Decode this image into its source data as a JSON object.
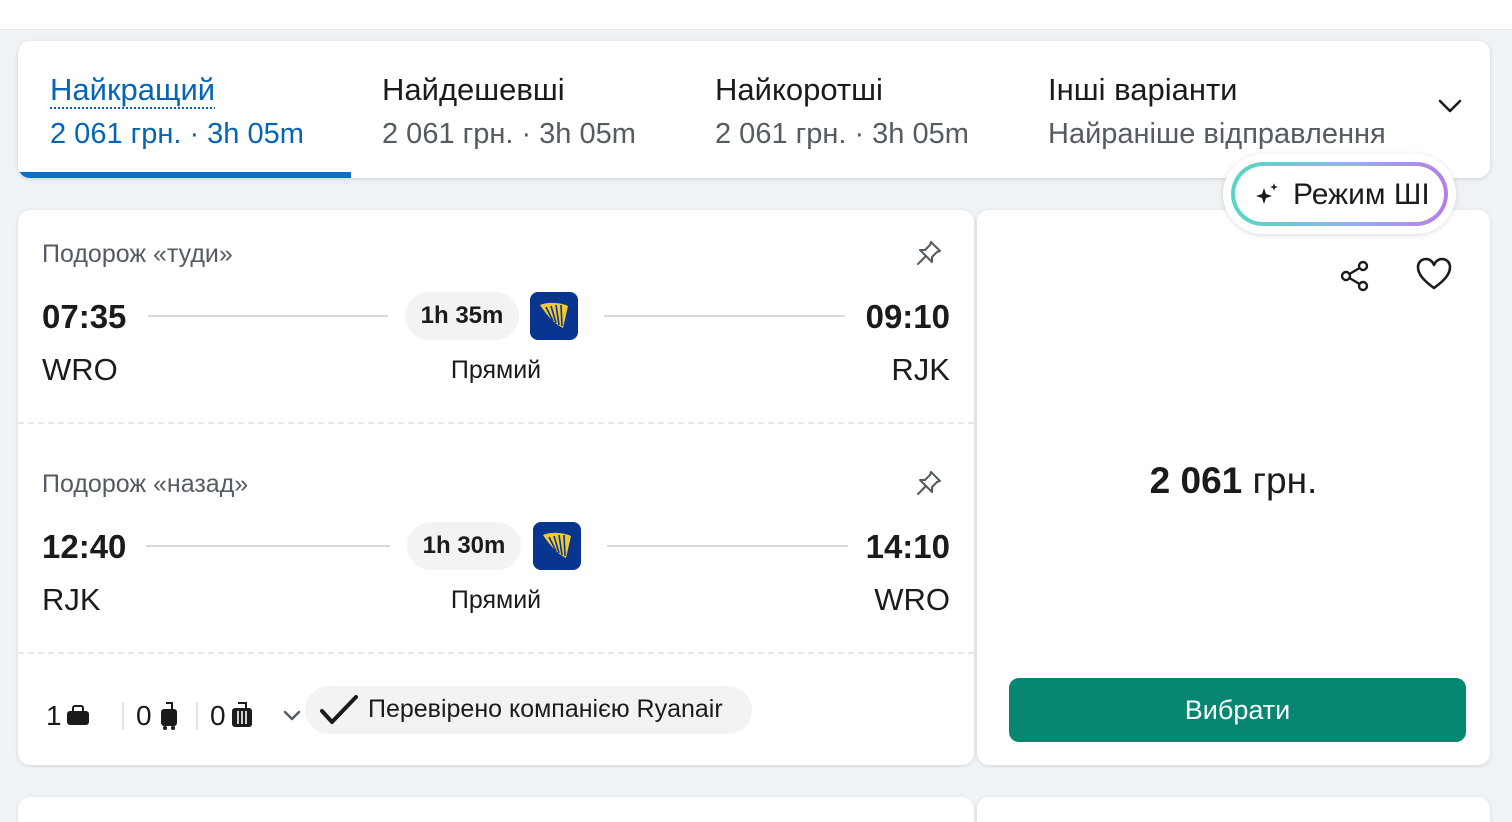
{
  "sort_tabs": [
    {
      "title": "Найкращий",
      "sub": "2 061 грн. · 3h 05m"
    },
    {
      "title": "Найдешевші",
      "sub": "2 061 грн. · 3h 05m"
    },
    {
      "title": "Найкоротші",
      "sub": "2 061 грн. · 3h 05m"
    },
    {
      "title": "Інші варіанти",
      "sub": "Найраніше відправлення"
    }
  ],
  "ai_mode": {
    "label": "Режим ШІ"
  },
  "result": {
    "outbound": {
      "label": "Подорож «туди»",
      "depart_time": "07:35",
      "arrive_time": "09:10",
      "from": "WRO",
      "to": "RJK",
      "duration": "1h 35m",
      "stops": "Прямий"
    },
    "return": {
      "label": "Подорож «назад»",
      "depart_time": "12:40",
      "arrive_time": "14:10",
      "from": "RJK",
      "to": "WRO",
      "duration": "1h 30m",
      "stops": "Прямий"
    },
    "bags": {
      "personal": "1",
      "carry_on": "0",
      "checked": "0"
    },
    "verified": "Перевірено компанією Ryanair",
    "price": "2 061",
    "currency": "грн.",
    "select_label": "Вибрати"
  },
  "colors": {
    "accent": "#0a71c8",
    "select": "#078771",
    "ryanair": "#073590"
  }
}
